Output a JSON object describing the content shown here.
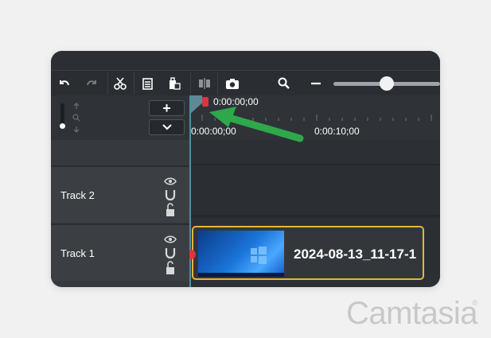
{
  "toolbar": {
    "buttons": [
      {
        "name": "undo-icon"
      },
      {
        "name": "redo-icon"
      },
      {
        "name": "cut-icon"
      },
      {
        "name": "copy-icon"
      },
      {
        "name": "paste-icon"
      },
      {
        "name": "split-icon"
      },
      {
        "name": "snapshot-icon"
      },
      {
        "name": "zoom-icon"
      },
      {
        "name": "zoom-out-icon"
      }
    ]
  },
  "header": {
    "add_label": "+",
    "more_label": "⌄"
  },
  "ruler": {
    "playhead_time": "0:00:00;00",
    "tick_start": "0:00:00;00",
    "tick_mid": "0:00:10;00"
  },
  "tracks": [
    {
      "label": "Track 2"
    },
    {
      "label": "Track 1"
    }
  ],
  "clip": {
    "title": "2024-08-13_11-17-1"
  },
  "branding": {
    "name": "Camtasia",
    "reg": "®"
  },
  "colors": {
    "clip_border": "#e6b43c",
    "playhead": "#d9363e",
    "arrow": "#2ea84a"
  }
}
